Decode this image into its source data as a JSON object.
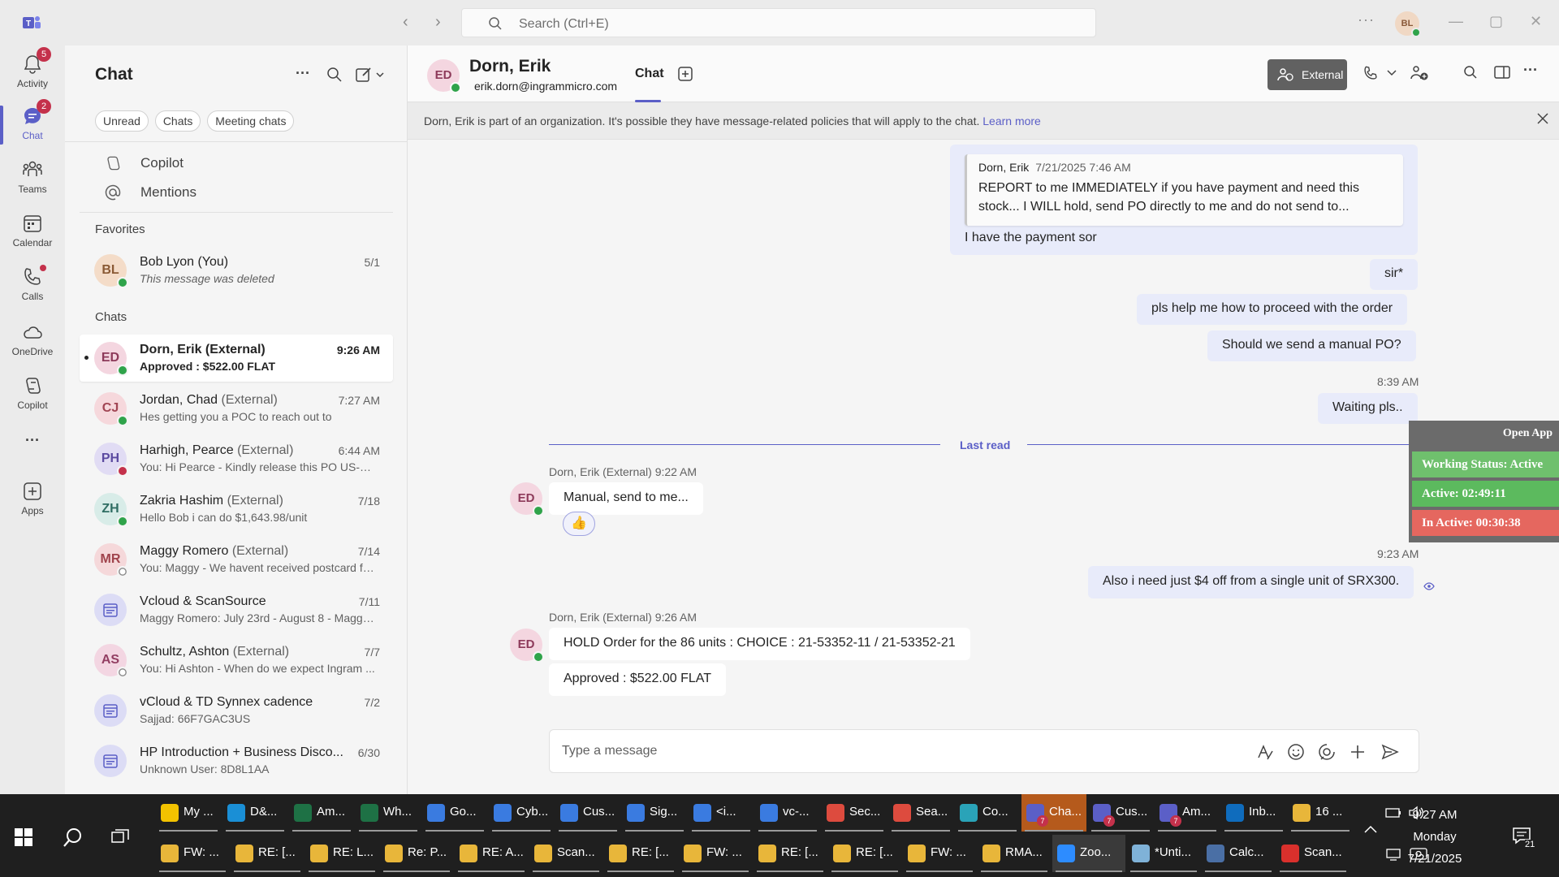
{
  "titlebar": {
    "search_placeholder": "Search (Ctrl+E)",
    "back": "‹",
    "forward": "›",
    "more": "···",
    "avatar_initials": "BL",
    "minimize": "—",
    "maximize": "▢",
    "close": "✕"
  },
  "rail": {
    "activity": {
      "label": "Activity",
      "badge": "5"
    },
    "chat": {
      "label": "Chat",
      "badge": "2"
    },
    "teams": {
      "label": "Teams"
    },
    "calendar": {
      "label": "Calendar"
    },
    "calls": {
      "label": "Calls"
    },
    "onedrive": {
      "label": "OneDrive"
    },
    "copilot": {
      "label": "Copilot"
    },
    "more": "···",
    "apps": {
      "label": "Apps"
    }
  },
  "chatlist": {
    "title": "Chat",
    "filters": [
      "Unread",
      "Chats",
      "Meeting chats"
    ],
    "copilot": "Copilot",
    "mentions": "Mentions",
    "favorites_label": "Favorites",
    "chats_label": "Chats",
    "favorites": [
      {
        "initials": "BL",
        "name": "Bob Lyon (You)",
        "ext": "",
        "preview": "This message was deleted",
        "time": "5/1",
        "status": "green"
      }
    ],
    "chats": [
      {
        "initials": "ED",
        "name": "Dorn, Erik",
        "ext": " (External)",
        "preview": "Approved : $522.00 FLAT",
        "time": "9:26 AM",
        "status": "green"
      },
      {
        "initials": "CJ",
        "name": "Jordan, Chad",
        "ext": " (External)",
        "preview": "Hes getting you a POC to reach out to",
        "time": "7:27 AM",
        "status": "green"
      },
      {
        "initials": "PH",
        "name": "Harhigh, Pearce",
        "ext": " (External)",
        "preview": "You: Hi Pearce -  Kindly release this PO US-Q3...",
        "time": "6:44 AM",
        "status": "red"
      },
      {
        "initials": "ZH",
        "name": "Zakria Hashim",
        "ext": " (External)",
        "preview": "Hello Bob i can do $1,643.98/unit",
        "time": "7/18",
        "status": "green"
      },
      {
        "initials": "MR",
        "name": "Maggy Romero",
        "ext": " (External)",
        "preview": "You: Maggy - We havent received postcard fo...",
        "time": "7/14",
        "status": "off"
      },
      {
        "initials": "",
        "name": "Vcloud & ScanSource",
        "ext": "",
        "preview": "Maggy Romero: July 23rd - August 8 - Maggy...",
        "time": "7/11",
        "status": ""
      },
      {
        "initials": "AS",
        "name": "Schultz, Ashton",
        "ext": " (External)",
        "preview": "You: Hi Ashton -  When do we expect Ingram ...",
        "time": "7/7",
        "status": "off"
      },
      {
        "initials": "",
        "name": "vCloud & TD Synnex cadence",
        "ext": "",
        "preview": "Sajjad: 66F7GAC3US",
        "time": "7/2",
        "status": ""
      },
      {
        "initials": "",
        "name": "HP Introduction + Business Disco...",
        "ext": "",
        "preview": "Unknown User: 8D8L1AA",
        "time": "6/30",
        "status": ""
      }
    ]
  },
  "header": {
    "initials": "ED",
    "name": "Dorn, Erik",
    "email": "erik.dorn@ingrammicro.com",
    "tab": "Chat",
    "external_label": "External"
  },
  "banner": {
    "text": "Dorn, Erik is part of an organization. It's possible they have message-related policies that will apply to the chat. ",
    "link": "Learn more"
  },
  "messages": {
    "quote_author": "Dorn, Erik",
    "quote_time": "7/21/2025 7:46 AM",
    "quote_text": "REPORT to me IMMEDIATELY if you have payment and need this stock... I WILL hold, send PO directly to me and do not send to...",
    "m1": "I have the payment sor",
    "m2": "sir*",
    "m3": "pls help me how to proceed with the order",
    "m4": "Should we send a manual PO?",
    "t839": "8:39 AM",
    "m5": "Waiting pls..",
    "last_read": "Last read",
    "e1_meta": "Dorn, Erik (External)   9:22 AM",
    "e1": "Manual, send to me...",
    "reaction": "👍",
    "t923": "9:23 AM",
    "m6": "Also i need just $4 off from a single unit of SRX300.",
    "e2_meta": "Dorn, Erik (External)   9:26 AM",
    "e2": "HOLD Order for the 86 units : CHOICE : 21-53352-11 / 21-53352-21",
    "e3": "Approved : $522.00 FLAT"
  },
  "compose": {
    "placeholder": "Type a message"
  },
  "tracker": {
    "header": "Open App",
    "working": "Working Status: Active",
    "active": "Active: 02:49:11",
    "inactive": "In Active: 00:30:38",
    "colors": {
      "working": "#6fc06d",
      "active": "#5cba5e",
      "inactive": "#e5675f"
    }
  },
  "taskbar": {
    "row1": [
      {
        "label": "My ...",
        "color": "#f2c200"
      },
      {
        "label": "D&...",
        "color": "#1a8fd6"
      },
      {
        "label": "Am...",
        "color": "#1e7145"
      },
      {
        "label": "Wh...",
        "color": "#1e7145"
      },
      {
        "label": "Go...",
        "color": "#3a7be0"
      },
      {
        "label": "Cyb...",
        "color": "#3a7be0"
      },
      {
        "label": "Cus...",
        "color": "#3a7be0"
      },
      {
        "label": "Sig...",
        "color": "#3a7be0"
      },
      {
        "label": "<i...",
        "color": "#3a7be0"
      },
      {
        "label": "vc-...",
        "color": "#3a7be0"
      },
      {
        "label": "Sec...",
        "color": "#dd4b3e"
      },
      {
        "label": "Sea...",
        "color": "#dd4b3e"
      },
      {
        "label": "Co...",
        "color": "#2aa3b8"
      },
      {
        "label": "Cha...",
        "color": "#5b5fc7",
        "count": "7"
      },
      {
        "label": "Cus...",
        "color": "#5b5fc7",
        "count": "7"
      },
      {
        "label": "Am...",
        "color": "#5b5fc7",
        "count": "7"
      },
      {
        "label": "Inb...",
        "color": "#0f6cbd"
      },
      {
        "label": "16 ...",
        "color": "#e8b63a"
      }
    ],
    "row2": [
      {
        "label": "FW: ...",
        "color": "#e8b63a"
      },
      {
        "label": "RE: [...",
        "color": "#e8b63a"
      },
      {
        "label": "RE: L...",
        "color": "#e8b63a"
      },
      {
        "label": "Re: P...",
        "color": "#e8b63a"
      },
      {
        "label": "RE: A...",
        "color": "#e8b63a"
      },
      {
        "label": "Scan...",
        "color": "#e8b63a"
      },
      {
        "label": "RE: [...",
        "color": "#e8b63a"
      },
      {
        "label": "FW: ...",
        "color": "#e8b63a"
      },
      {
        "label": "RE: [...",
        "color": "#e8b63a"
      },
      {
        "label": "RE: [...",
        "color": "#e8b63a"
      },
      {
        "label": "FW: ...",
        "color": "#e8b63a"
      },
      {
        "label": "RMA...",
        "color": "#e8b63a"
      },
      {
        "label": "Zoo...",
        "color": "#2d8cff"
      },
      {
        "label": "*Unti...",
        "color": "#7fb2d8"
      },
      {
        "label": "Calc...",
        "color": "#4a6fa5"
      },
      {
        "label": "Scan...",
        "color": "#d9302c"
      }
    ],
    "time": "9:27 AM",
    "day": "Monday",
    "date": "7/21/2025",
    "notif_count": "21"
  }
}
